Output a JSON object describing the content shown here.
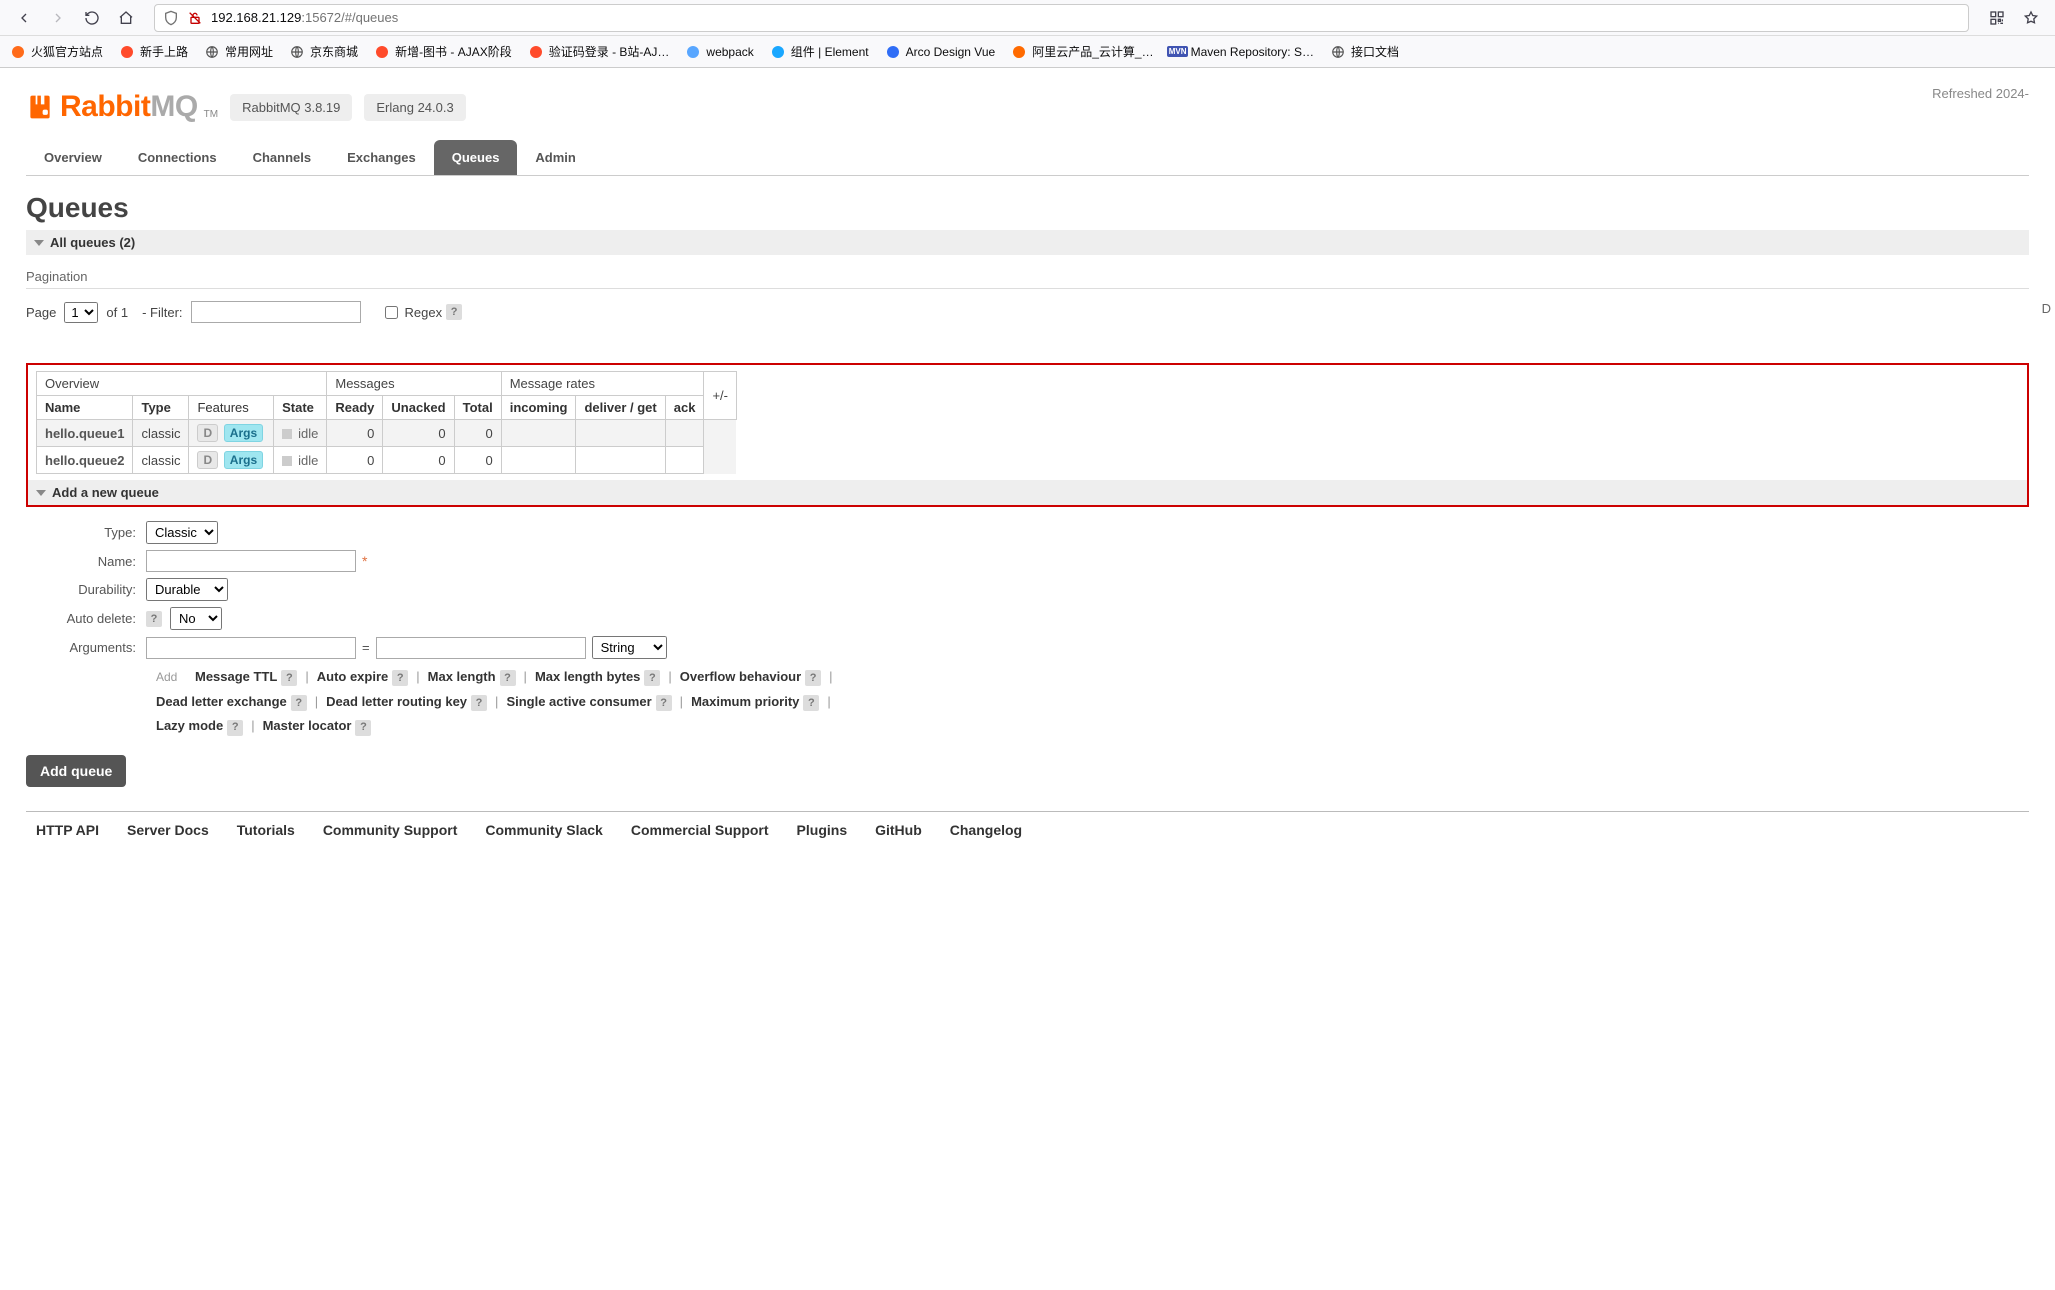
{
  "browser": {
    "url_host": "192.168.21.129",
    "url_rest": ":15672/#/queues",
    "bookmarks": [
      {
        "label": "火狐官方站点",
        "color": "#ff6b1a",
        "has_globe": false
      },
      {
        "label": "新手上路",
        "color": "#ff4b2b",
        "has_globe": false
      },
      {
        "label": "常用网址",
        "color": "",
        "has_globe": true
      },
      {
        "label": "京东商城",
        "color": "",
        "has_globe": true
      },
      {
        "label": "新增-图书 - AJAX阶段",
        "color": "#ff4b2b",
        "has_globe": false
      },
      {
        "label": "验证码登录 - B站-AJ…",
        "color": "#ff4b2b",
        "has_globe": false
      },
      {
        "label": "webpack",
        "color": "#58a6ff",
        "has_globe": false
      },
      {
        "label": "组件 | Element",
        "color": "#1aa7ff",
        "has_globe": false
      },
      {
        "label": "Arco Design Vue",
        "color": "#2f6df6",
        "has_globe": false
      },
      {
        "label": "阿里云产品_云计算_…",
        "color": "#ff6a00",
        "has_globe": false
      },
      {
        "label": "Maven Repository: S…",
        "color": "#4054b2",
        "has_globe": false,
        "mvn": true
      },
      {
        "label": "接口文档",
        "color": "",
        "has_globe": true
      }
    ]
  },
  "header": {
    "logo_left": "Rabbit",
    "logo_right": "MQ",
    "tm": "TM",
    "version_badge": "RabbitMQ 3.8.19",
    "erlang_badge": "Erlang 24.0.3",
    "refreshed": "Refreshed 2024-"
  },
  "tabs": [
    "Overview",
    "Connections",
    "Channels",
    "Exchanges",
    "Queues",
    "Admin"
  ],
  "tabs_selected_index": 4,
  "page_title": "Queues",
  "sections": {
    "all_queues": "All queues (2)",
    "add_new": "Add a new queue"
  },
  "pagination": {
    "heading": "Pagination",
    "page_label": "Page",
    "page_value": "1",
    "of_text": "of 1",
    "filter_label": "- Filter:",
    "filter_value": "",
    "regex_label": "Regex",
    "regex_checked": false,
    "right_letter": "D"
  },
  "table": {
    "group_headers": [
      "Overview",
      "Messages",
      "Message rates",
      "+/-"
    ],
    "columns_overview": [
      "Name",
      "Type",
      "Features",
      "State"
    ],
    "columns_messages": [
      "Ready",
      "Unacked",
      "Total"
    ],
    "columns_rates": [
      "incoming",
      "deliver / get",
      "ack"
    ],
    "rows": [
      {
        "name": "hello.queue1",
        "type": "classic",
        "features": [
          "D",
          "Args"
        ],
        "state": "idle",
        "ready": "0",
        "unacked": "0",
        "total": "0",
        "incoming": "",
        "deliver": "",
        "ack": ""
      },
      {
        "name": "hello.queue2",
        "type": "classic",
        "features": [
          "D",
          "Args"
        ],
        "state": "idle",
        "ready": "0",
        "unacked": "0",
        "total": "0",
        "incoming": "",
        "deliver": "",
        "ack": ""
      }
    ],
    "plusminus": "+/-"
  },
  "form": {
    "type_label": "Type:",
    "type_value": "Classic",
    "name_label": "Name:",
    "name_value": "",
    "dur_label": "Durability:",
    "dur_value": "Durable",
    "autodel_label": "Auto delete:",
    "autodel_value": "No",
    "args_label": "Arguments:",
    "args_key": "",
    "args_val": "",
    "args_type": "String",
    "add_mini": "Add",
    "shortcuts": [
      "Message TTL",
      "Auto expire",
      "Max length",
      "Max length bytes",
      "Overflow behaviour",
      "Dead letter exchange",
      "Dead letter routing key",
      "Single active consumer",
      "Maximum priority",
      "Lazy mode",
      "Master locator"
    ],
    "submit": "Add queue"
  },
  "footer": [
    "HTTP API",
    "Server Docs",
    "Tutorials",
    "Community Support",
    "Community Slack",
    "Commercial Support",
    "Plugins",
    "GitHub",
    "Changelog"
  ]
}
